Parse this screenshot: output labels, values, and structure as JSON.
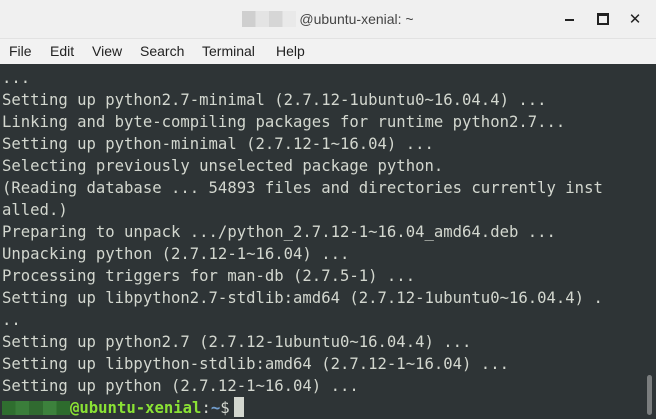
{
  "window": {
    "title": "@ubuntu-xenial: ~",
    "controls": [
      "minimize-icon",
      "maximize-icon",
      "close-icon"
    ]
  },
  "menu": [
    "File",
    "Edit",
    "View",
    "Search",
    "Terminal",
    "Help"
  ],
  "terminal": {
    "lines": [
      "...",
      "Setting up python2.7-minimal (2.7.12-1ubuntu0~16.04.4) ...",
      "Linking and byte-compiling packages for runtime python2.7...",
      "Setting up python-minimal (2.7.12-1~16.04) ...",
      "Selecting previously unselected package python.",
      "(Reading database ... 54893 files and directories currently inst",
      "alled.)",
      "Preparing to unpack .../python_2.7.12-1~16.04_amd64.deb ...",
      "Unpacking python (2.7.12-1~16.04) ...",
      "Processing triggers for man-db (2.7.5-1) ...",
      "Setting up libpython2.7-stdlib:amd64 (2.7.12-1ubuntu0~16.04.4) .",
      "..",
      "Setting up python2.7 (2.7.12-1ubuntu0~16.04.4) ...",
      "Setting up libpython-stdlib:amd64 (2.7.12-1~16.04) ...",
      "Setting up python (2.7.12-1~16.04) ..."
    ],
    "prompt": {
      "host": "@ubuntu-xenial",
      "separator": ":",
      "path": "~",
      "symbol": "$"
    }
  },
  "colors": {
    "terminal_bg": "#2e3436",
    "terminal_fg": "#d3d7cf",
    "prompt_host": "#8ae234",
    "prompt_path": "#729fcf"
  }
}
